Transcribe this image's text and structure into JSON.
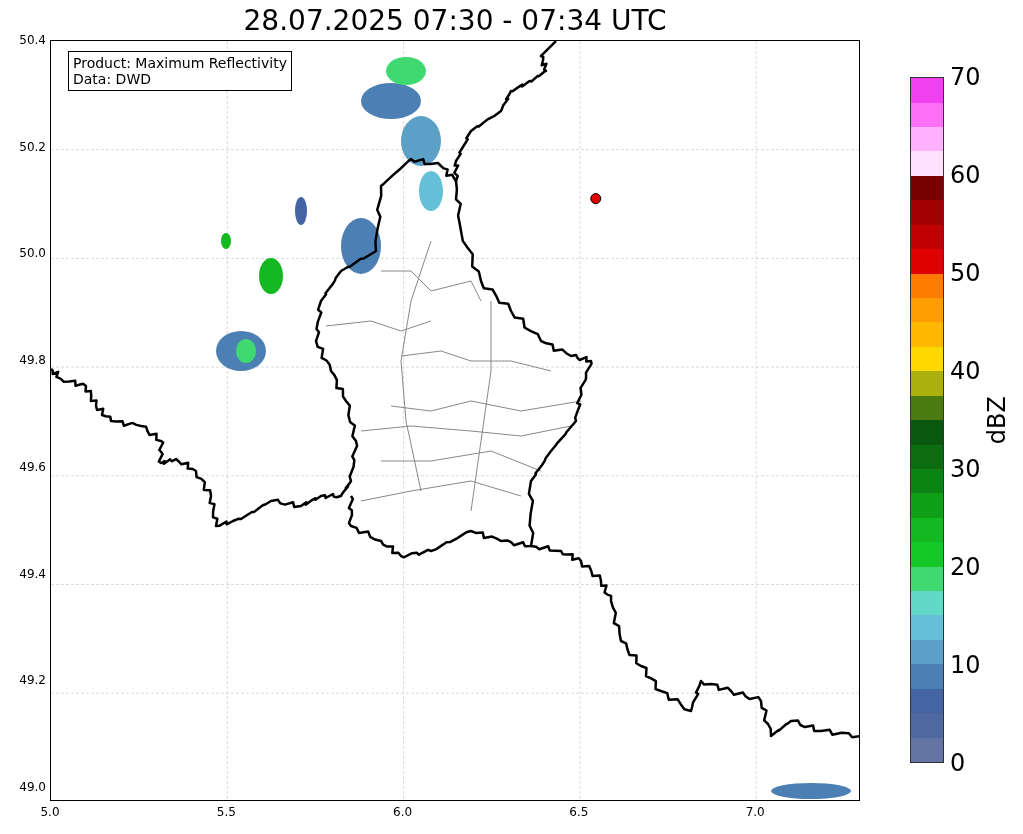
{
  "title": "28.07.2025 07:30 - 07:34 UTC",
  "legend": {
    "lines": [
      "Product: Maximum Reflectivity",
      "Data: DWD"
    ]
  },
  "xticks": [
    "5.0",
    "5.5",
    "6.0",
    "6.5",
    "7.0"
  ],
  "yticks": [
    "50.4",
    "50.2",
    "50.0",
    "49.8",
    "49.6",
    "49.4",
    "49.2",
    "49.0"
  ],
  "colorbar": {
    "label": "dBZ",
    "ticks": [
      "70",
      "60",
      "50",
      "40",
      "30",
      "20",
      "10",
      "0"
    ],
    "segments": [
      {
        "color": "#6474a4"
      },
      {
        "color": "#5068a0"
      },
      {
        "color": "#4464a4"
      },
      {
        "color": "#4c80b4"
      },
      {
        "color": "#5ca0c8"
      },
      {
        "color": "#64c0d8"
      },
      {
        "color": "#64d8c8"
      },
      {
        "color": "#40d870"
      },
      {
        "color": "#14c828"
      },
      {
        "color": "#14b820"
      },
      {
        "color": "#10a018"
      },
      {
        "color": "#0c8414"
      },
      {
        "color": "#0c6c10"
      },
      {
        "color": "#0a5810"
      },
      {
        "color": "#4a7a10"
      },
      {
        "color": "#acb00c"
      },
      {
        "color": "#ffd800"
      },
      {
        "color": "#ffb800"
      },
      {
        "color": "#ff9c00"
      },
      {
        "color": "#ff7c00"
      },
      {
        "color": "#e00000"
      },
      {
        "color": "#c00000"
      },
      {
        "color": "#a00000"
      },
      {
        "color": "#780000"
      },
      {
        "color": "#ffe0ff"
      },
      {
        "color": "#ffb0ff"
      },
      {
        "color": "#ff70f8"
      },
      {
        "color": "#f040f0"
      }
    ]
  }
}
